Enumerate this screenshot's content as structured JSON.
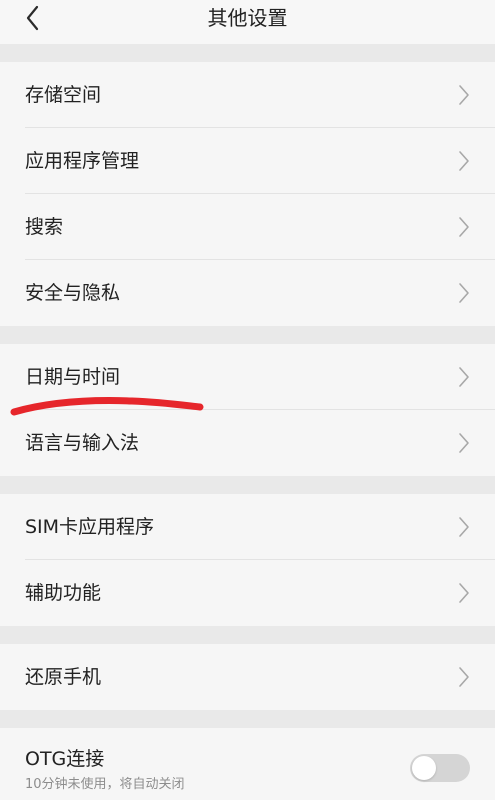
{
  "header": {
    "title": "其他设置",
    "back_icon": "chevron-left-icon"
  },
  "groups": [
    {
      "items": [
        {
          "label": "存储空间"
        },
        {
          "label": "应用程序管理"
        },
        {
          "label": "搜索"
        },
        {
          "label": "安全与隐私"
        }
      ]
    },
    {
      "items": [
        {
          "label": "日期与时间"
        },
        {
          "label": "语言与输入法"
        }
      ]
    },
    {
      "items": [
        {
          "label": "SIM卡应用程序"
        },
        {
          "label": "辅助功能"
        }
      ]
    },
    {
      "items": [
        {
          "label": "还原手机"
        }
      ]
    }
  ],
  "otg": {
    "title": "OTG连接",
    "subtitle": "10分钟未使用，将自动关闭",
    "enabled": false
  },
  "colors": {
    "page_background": "#f4f4f4",
    "gap_background": "#e9e9e9",
    "annotation_stroke": "#e6262b",
    "toggle_off": "#d5d5d5"
  },
  "icons": {
    "row_chevron": "chevron-right-icon",
    "annotation": "red-underline-annotation"
  }
}
